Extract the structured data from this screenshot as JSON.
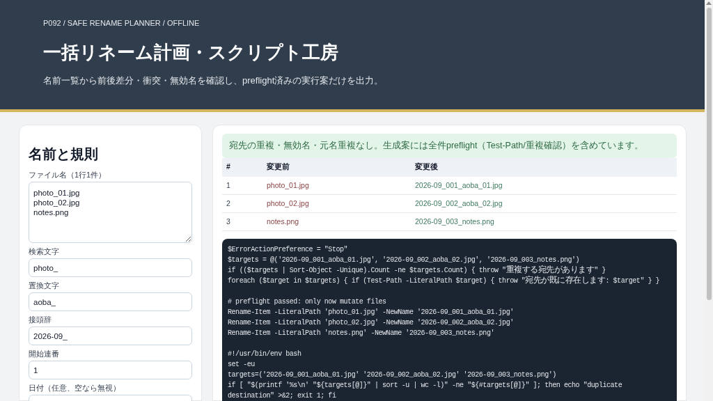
{
  "header": {
    "breadcrumb": "P092 / SAFE RENAME PLANNER / OFFLINE",
    "title": "一括リネーム計画・スクリプト工房",
    "subtitle": "名前一覧から前後差分・衝突・無効名を確認し、preflight済みの実行案だけを出力。"
  },
  "form": {
    "title": "名前と規則",
    "fields": [
      {
        "kind": "textarea",
        "label": "ファイル名（1行1件）",
        "value": "photo_01.jpg\nphoto_02.jpg\nnotes.png"
      },
      {
        "kind": "input",
        "label": "検索文字",
        "value": "photo_"
      },
      {
        "kind": "input",
        "label": "置換文字",
        "value": "aoba_"
      },
      {
        "kind": "input",
        "label": "接頭辞",
        "value": "2026-09_"
      },
      {
        "kind": "input",
        "label": "開始連番",
        "value": "1"
      },
      {
        "kind": "input",
        "label": "日付（任意、空なら無視）"
      }
    ]
  },
  "result": {
    "notice": "宛先の重複・無効名・元名重複なし。生成案には全件preflight（Test-Path/重複確認）を含めています。",
    "table": {
      "columns": [
        "#",
        "変更前",
        "変更後"
      ],
      "rows": [
        [
          "1",
          "photo_01.jpg",
          "2026-09_001_aoba_01.jpg"
        ],
        [
          "2",
          "photo_02.jpg",
          "2026-09_002_aoba_02.jpg"
        ],
        [
          "3",
          "notes.png",
          "2026-09_003_notes.png"
        ]
      ]
    },
    "code": {
      "blocks": [
        [
          "$ErrorActionPreference = \"Stop\"",
          "$targets = @('2026-09_001_aoba_01.jpg', '2026-09_002_aoba_02.jpg', '2026-09_003_notes.png')",
          "if (($targets | Sort-Object -Unique).Count -ne $targets.Count) { throw \"重複する宛先があります\" }",
          "foreach ($target in $targets) { if (Test-Path -LiteralPath $target) { throw \"宛先が既に存在します: $target\" } }"
        ],
        [
          "# preflight passed: only now mutate files",
          "Rename-Item -LiteralPath 'photo_01.jpg' -NewName '2026-09_001_aoba_01.jpg'",
          "Rename-Item -LiteralPath 'photo_02.jpg' -NewName '2026-09_002_aoba_02.jpg'",
          "Rename-Item -LiteralPath 'notes.png' -NewName '2026-09_003_notes.png'"
        ],
        [
          "#!/usr/bin/env bash",
          "set -eu",
          "targets=('2026-09_001_aoba_01.jpg' '2026-09_002_aoba_02.jpg' '2026-09_003_notes.png')",
          "if [ \"$(printf '%s\\n' \"${targets[@]}\" | sort -u | wc -l)\" -ne \"${#targets[@]}\" ]; then echo \"duplicate destination\" >&2; exit 1; fi"
        ]
      ]
    }
  }
}
